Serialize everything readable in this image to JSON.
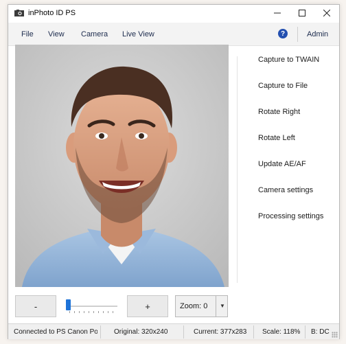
{
  "window": {
    "title": "inPhoto ID PS"
  },
  "menu": {
    "file": "File",
    "view": "View",
    "camera": "Camera",
    "live_view": "Live View",
    "help": "?",
    "admin": "Admin"
  },
  "side_actions": [
    "Capture to TWAIN",
    "Capture to File",
    "Rotate Right",
    "Rotate Left",
    "Update AE/AF",
    "Camera settings",
    "Processing settings"
  ],
  "controls": {
    "minus_label": "-",
    "plus_label": "+",
    "zoom_value": "Zoom: 0",
    "zoom_slider_level": 0
  },
  "status": {
    "connection": "Connected to PS Canon Po",
    "original": "Original: 320x240",
    "current": "Current: 377x283",
    "scale": "Scale: 118%",
    "mode": "B: DC"
  },
  "colors": {
    "accent": "#1e73d8",
    "help_icon": "#2450b0"
  },
  "icons": {
    "window_minimize": "minimize-icon",
    "window_maximize": "maximize-icon",
    "window_close": "close-icon",
    "zoom_dropdown": "chevron-down-icon"
  }
}
